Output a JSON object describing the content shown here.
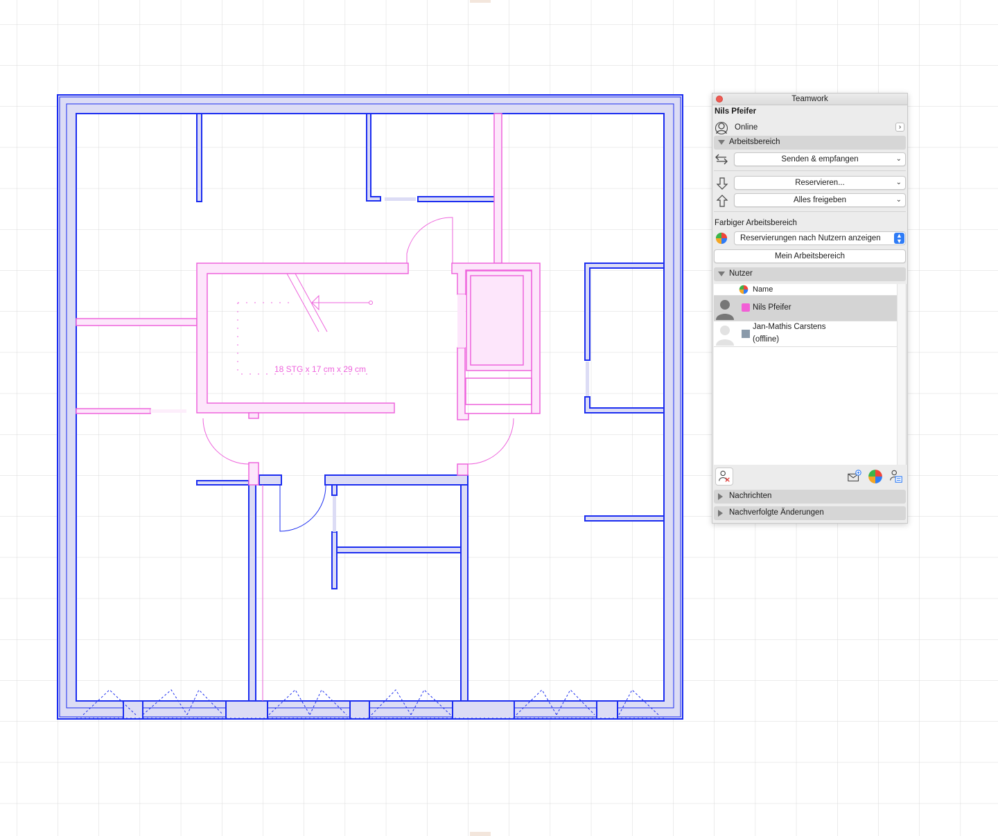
{
  "floor_plan": {
    "stair_label": "18 STG x 17 cm x 29 cm"
  },
  "palette": {
    "title": "Teamwork",
    "current_user": "Nils Pfeifer",
    "status": {
      "label": "Online",
      "icon": "user-status-icon"
    },
    "workspace_section": {
      "label": "Arbeitsbereich",
      "send_receive": "Senden & empfangen",
      "reserve": "Reservieren...",
      "release_all": "Alles freigeben"
    },
    "colored_workspace": {
      "label": "Farbiger Arbeitsbereich",
      "mode": "Reservierungen nach Nutzern anzeigen",
      "my_workspace": "Mein Arbeitsbereich"
    },
    "users_section": {
      "label": "Nutzer",
      "column_name": "Name",
      "users": [
        {
          "name": "Nils Pfeifer",
          "status": "",
          "color": "#f25fd6",
          "selected": true
        },
        {
          "name": "Jan-Mathis Carstens",
          "status": "(offline)",
          "color": "#8a9aaa",
          "selected": false
        }
      ]
    },
    "messages_section": {
      "label": "Nachrichten"
    },
    "tracked_changes_section": {
      "label": "Nachverfolgte Änderungen"
    }
  },
  "colors": {
    "wall_blue": "#1a2cf0",
    "wall_fill": "#dcdcf5",
    "reserved_pink": "#ee63dc",
    "reserved_fill": "#fde6fb",
    "grid": "#d9d9d9"
  }
}
